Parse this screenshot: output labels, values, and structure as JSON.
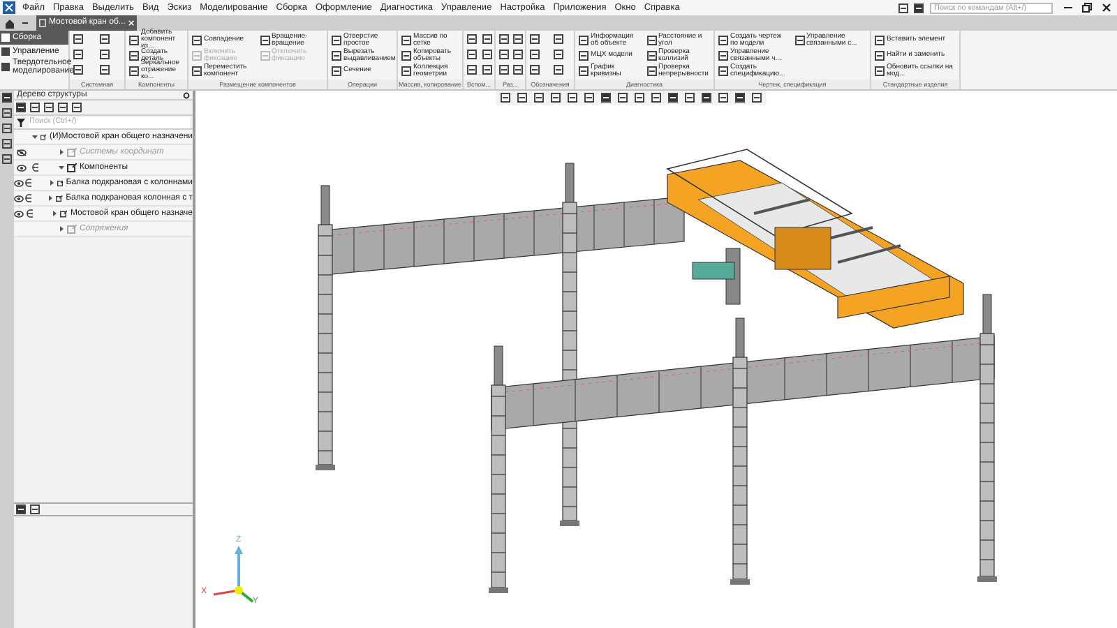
{
  "menu": [
    "Файл",
    "Правка",
    "Выделить",
    "Вид",
    "Эскиз",
    "Моделирование",
    "Сборка",
    "Оформление",
    "Диагностика",
    "Управление",
    "Настройка",
    "Приложения",
    "Окно",
    "Справка"
  ],
  "search": {
    "placeholder": "Поиск по командам (Alt+/)"
  },
  "document_tab": {
    "title": "Мостовой кран об...",
    "selected": true
  },
  "modes": [
    {
      "label": "Сборка",
      "selected": true
    },
    {
      "label": "Управление",
      "selected": false
    },
    {
      "label": "Твердотельное моделирование",
      "selected": false
    }
  ],
  "ribbon_groups": [
    {
      "label": "Системная",
      "kind": "icons"
    },
    {
      "label": "Компоненты",
      "kind": "commands",
      "commands": [
        {
          "label": "Добавить компонент из...",
          "disabled": false
        },
        {
          "label": "Создать деталь",
          "disabled": false
        },
        {
          "label": "Зеркальное отражение ко...",
          "disabled": false
        }
      ]
    },
    {
      "label": "Размещение компонентов",
      "kind": "commands",
      "commands": [
        {
          "label": "Совпадение",
          "disabled": false
        },
        {
          "label": "Включить фиксацию",
          "disabled": true
        },
        {
          "label": "Переместить компонент",
          "disabled": false
        },
        {
          "label": "Вращение-вращение",
          "disabled": false
        },
        {
          "label": "Отключить фиксацию",
          "disabled": true
        }
      ]
    },
    {
      "label": "Операции",
      "kind": "commands",
      "commands": [
        {
          "label": "Отверстие простое",
          "disabled": false
        },
        {
          "label": "Вырезать выдавливанием",
          "disabled": false
        },
        {
          "label": "Сечение",
          "disabled": false
        }
      ]
    },
    {
      "label": "Массив, копирование",
      "kind": "commands",
      "commands": [
        {
          "label": "Массив по сетке",
          "disabled": false
        },
        {
          "label": "Копировать объекты",
          "disabled": false
        },
        {
          "label": "Коллекция геометрии",
          "disabled": false
        }
      ]
    },
    {
      "label": "Вспом...",
      "kind": "icons"
    },
    {
      "label": "Раз...",
      "kind": "icons"
    },
    {
      "label": "Обозначения",
      "kind": "icons"
    },
    {
      "label": "Диагностика",
      "kind": "commands",
      "commands": [
        {
          "label": "Информация об объекте",
          "disabled": false
        },
        {
          "label": "МЦХ модели",
          "disabled": false
        },
        {
          "label": "График кривизны",
          "disabled": false
        },
        {
          "label": "Расстояние и угол",
          "disabled": false
        },
        {
          "label": "Проверка коллизий",
          "disabled": false
        },
        {
          "label": "Проверка непрерывности",
          "disabled": false
        }
      ]
    },
    {
      "label": "Чертеж, спецификация",
      "kind": "commands",
      "commands": [
        {
          "label": "Создать чертеж по модели",
          "disabled": false
        },
        {
          "label": "Управление связанными ч...",
          "disabled": false
        },
        {
          "label": "Создать спецификацию...",
          "disabled": false
        },
        {
          "label": "Управление связанными с...",
          "disabled": false
        }
      ]
    },
    {
      "label": "Стандартные изделия",
      "kind": "commands",
      "commands": [
        {
          "label": "Вставить элемент",
          "disabled": false
        },
        {
          "label": "Найти и заменить",
          "disabled": false
        },
        {
          "label": "Обновить ссылки на мод...",
          "disabled": false
        }
      ]
    }
  ],
  "tree_panel": {
    "title": "Дерево структуры",
    "search": {
      "placeholder": "Поиск (Ctrl+/)"
    },
    "items": [
      {
        "label": "(И)Мостовой кран общего назначени",
        "expanded": true,
        "dimmed": false,
        "children": [
          {
            "label": "Системы координат",
            "expanded": false,
            "dimmed": true,
            "visible": false
          },
          {
            "label": "Компоненты",
            "expanded": true,
            "dimmed": false,
            "visible": true,
            "children": [
              {
                "label": "Балка подкрановая с колоннами",
                "expanded": false,
                "dimmed": false,
                "visible": true
              },
              {
                "label": "Балка подкрановая колонная с т",
                "expanded": false,
                "dimmed": false,
                "visible": true
              },
              {
                "label": "Мостовой кран общего назначе",
                "expanded": false,
                "dimmed": false,
                "visible": true
              }
            ]
          },
          {
            "label": "Сопряжения",
            "expanded": false,
            "dimmed": true
          }
        ]
      }
    ]
  },
  "axis_labels": [
    "X",
    "Y",
    "Z"
  ]
}
